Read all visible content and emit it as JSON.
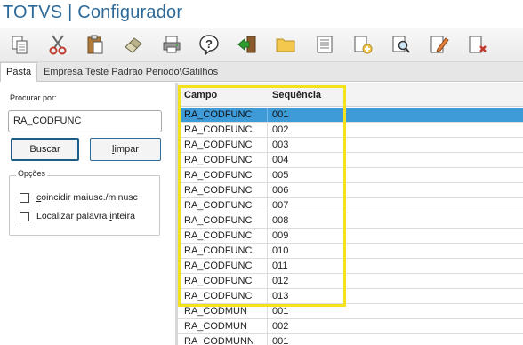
{
  "window": {
    "title": "TOTVS | Configurador"
  },
  "toolbar": {
    "buttons": [
      {
        "icon": "copy-icon"
      },
      {
        "icon": "cut-icon"
      },
      {
        "icon": "paste-icon"
      },
      {
        "icon": "eraser-icon"
      },
      {
        "icon": "print-icon"
      },
      {
        "icon": "help-icon"
      },
      {
        "icon": "exit-icon"
      },
      {
        "icon": "folder-icon"
      },
      {
        "icon": "view-icon"
      },
      {
        "icon": "add-icon"
      },
      {
        "icon": "search-doc-icon"
      },
      {
        "icon": "edit-icon"
      },
      {
        "icon": "delete-icon"
      }
    ]
  },
  "tabs": {
    "active": "Pasta",
    "path": "Empresa Teste Padrao Periodo\\Gatilhos"
  },
  "search": {
    "label": "Procurar por:",
    "value": "RA_CODFUNC",
    "buscar_label": "Buscar",
    "limpar_first": "l",
    "limpar_rest": "impar"
  },
  "options": {
    "title": "Opções",
    "match_case_first": "c",
    "match_case_rest": "oincidir maiusc./minusc",
    "whole_word_before": "Localizar palavra ",
    "whole_word_underlined": "i",
    "whole_word_after": "nteira"
  },
  "grid": {
    "headers": {
      "campo": "Campo",
      "sequencia": "Sequência"
    },
    "rows": [
      {
        "campo": "RA_CODFUNC",
        "sequencia": "001",
        "selected": true
      },
      {
        "campo": "RA_CODFUNC",
        "sequencia": "002"
      },
      {
        "campo": "RA_CODFUNC",
        "sequencia": "003"
      },
      {
        "campo": "RA_CODFUNC",
        "sequencia": "004"
      },
      {
        "campo": "RA_CODFUNC",
        "sequencia": "005"
      },
      {
        "campo": "RA_CODFUNC",
        "sequencia": "006"
      },
      {
        "campo": "RA_CODFUNC",
        "sequencia": "007"
      },
      {
        "campo": "RA_CODFUNC",
        "sequencia": "008"
      },
      {
        "campo": "RA_CODFUNC",
        "sequencia": "009"
      },
      {
        "campo": "RA_CODFUNC",
        "sequencia": "010"
      },
      {
        "campo": "RA_CODFUNC",
        "sequencia": "011"
      },
      {
        "campo": "RA_CODFUNC",
        "sequencia": "012"
      },
      {
        "campo": "RA_CODFUNC",
        "sequencia": "013"
      },
      {
        "campo": "RA_CODMUN",
        "sequencia": "001"
      },
      {
        "campo": "RA_CODMUN",
        "sequencia": "002"
      },
      {
        "campo": "RA_CODMUNN",
        "sequencia": "001"
      }
    ]
  },
  "colors": {
    "title": "#2e6a99",
    "selection": "#3f9bd8",
    "highlight": "#f4e21d",
    "buscar_border": "#1d5c86"
  }
}
